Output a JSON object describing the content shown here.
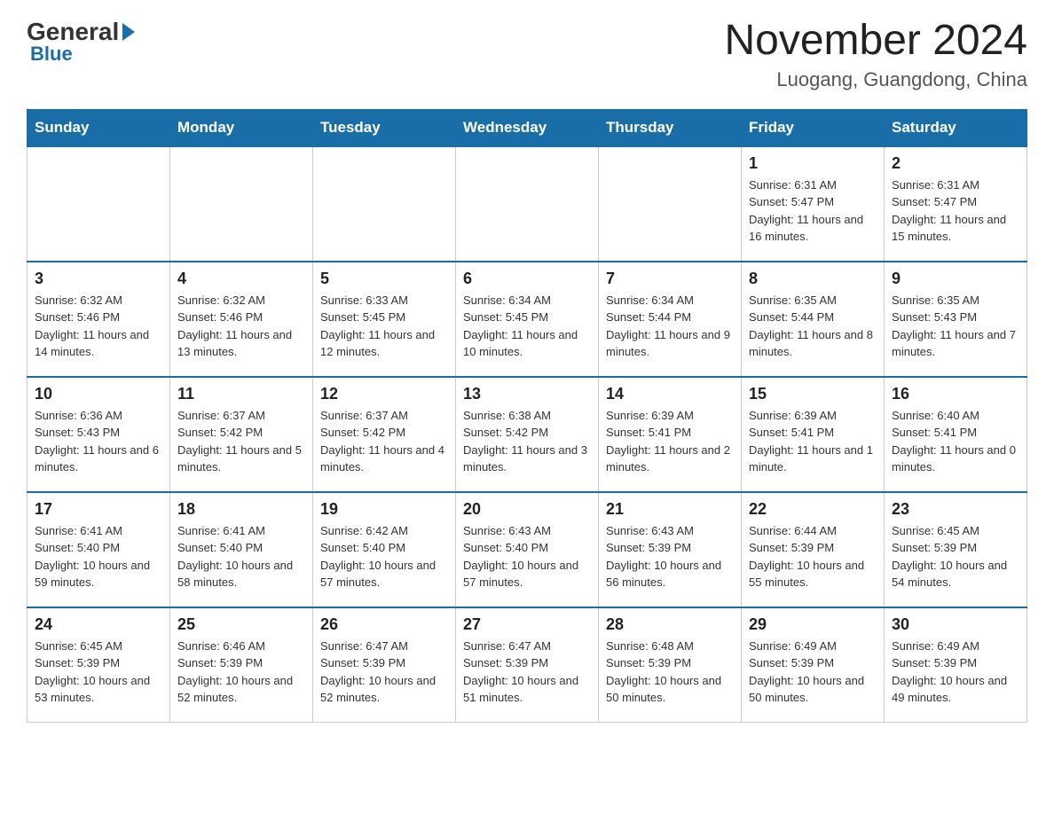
{
  "header": {
    "logo_general": "General",
    "logo_blue": "Blue",
    "month_title": "November 2024",
    "location": "Luogang, Guangdong, China"
  },
  "weekdays": [
    "Sunday",
    "Monday",
    "Tuesday",
    "Wednesday",
    "Thursday",
    "Friday",
    "Saturday"
  ],
  "weeks": [
    [
      {
        "day": "",
        "info": ""
      },
      {
        "day": "",
        "info": ""
      },
      {
        "day": "",
        "info": ""
      },
      {
        "day": "",
        "info": ""
      },
      {
        "day": "",
        "info": ""
      },
      {
        "day": "1",
        "info": "Sunrise: 6:31 AM\nSunset: 5:47 PM\nDaylight: 11 hours and 16 minutes."
      },
      {
        "day": "2",
        "info": "Sunrise: 6:31 AM\nSunset: 5:47 PM\nDaylight: 11 hours and 15 minutes."
      }
    ],
    [
      {
        "day": "3",
        "info": "Sunrise: 6:32 AM\nSunset: 5:46 PM\nDaylight: 11 hours and 14 minutes."
      },
      {
        "day": "4",
        "info": "Sunrise: 6:32 AM\nSunset: 5:46 PM\nDaylight: 11 hours and 13 minutes."
      },
      {
        "day": "5",
        "info": "Sunrise: 6:33 AM\nSunset: 5:45 PM\nDaylight: 11 hours and 12 minutes."
      },
      {
        "day": "6",
        "info": "Sunrise: 6:34 AM\nSunset: 5:45 PM\nDaylight: 11 hours and 10 minutes."
      },
      {
        "day": "7",
        "info": "Sunrise: 6:34 AM\nSunset: 5:44 PM\nDaylight: 11 hours and 9 minutes."
      },
      {
        "day": "8",
        "info": "Sunrise: 6:35 AM\nSunset: 5:44 PM\nDaylight: 11 hours and 8 minutes."
      },
      {
        "day": "9",
        "info": "Sunrise: 6:35 AM\nSunset: 5:43 PM\nDaylight: 11 hours and 7 minutes."
      }
    ],
    [
      {
        "day": "10",
        "info": "Sunrise: 6:36 AM\nSunset: 5:43 PM\nDaylight: 11 hours and 6 minutes."
      },
      {
        "day": "11",
        "info": "Sunrise: 6:37 AM\nSunset: 5:42 PM\nDaylight: 11 hours and 5 minutes."
      },
      {
        "day": "12",
        "info": "Sunrise: 6:37 AM\nSunset: 5:42 PM\nDaylight: 11 hours and 4 minutes."
      },
      {
        "day": "13",
        "info": "Sunrise: 6:38 AM\nSunset: 5:42 PM\nDaylight: 11 hours and 3 minutes."
      },
      {
        "day": "14",
        "info": "Sunrise: 6:39 AM\nSunset: 5:41 PM\nDaylight: 11 hours and 2 minutes."
      },
      {
        "day": "15",
        "info": "Sunrise: 6:39 AM\nSunset: 5:41 PM\nDaylight: 11 hours and 1 minute."
      },
      {
        "day": "16",
        "info": "Sunrise: 6:40 AM\nSunset: 5:41 PM\nDaylight: 11 hours and 0 minutes."
      }
    ],
    [
      {
        "day": "17",
        "info": "Sunrise: 6:41 AM\nSunset: 5:40 PM\nDaylight: 10 hours and 59 minutes."
      },
      {
        "day": "18",
        "info": "Sunrise: 6:41 AM\nSunset: 5:40 PM\nDaylight: 10 hours and 58 minutes."
      },
      {
        "day": "19",
        "info": "Sunrise: 6:42 AM\nSunset: 5:40 PM\nDaylight: 10 hours and 57 minutes."
      },
      {
        "day": "20",
        "info": "Sunrise: 6:43 AM\nSunset: 5:40 PM\nDaylight: 10 hours and 57 minutes."
      },
      {
        "day": "21",
        "info": "Sunrise: 6:43 AM\nSunset: 5:39 PM\nDaylight: 10 hours and 56 minutes."
      },
      {
        "day": "22",
        "info": "Sunrise: 6:44 AM\nSunset: 5:39 PM\nDaylight: 10 hours and 55 minutes."
      },
      {
        "day": "23",
        "info": "Sunrise: 6:45 AM\nSunset: 5:39 PM\nDaylight: 10 hours and 54 minutes."
      }
    ],
    [
      {
        "day": "24",
        "info": "Sunrise: 6:45 AM\nSunset: 5:39 PM\nDaylight: 10 hours and 53 minutes."
      },
      {
        "day": "25",
        "info": "Sunrise: 6:46 AM\nSunset: 5:39 PM\nDaylight: 10 hours and 52 minutes."
      },
      {
        "day": "26",
        "info": "Sunrise: 6:47 AM\nSunset: 5:39 PM\nDaylight: 10 hours and 52 minutes."
      },
      {
        "day": "27",
        "info": "Sunrise: 6:47 AM\nSunset: 5:39 PM\nDaylight: 10 hours and 51 minutes."
      },
      {
        "day": "28",
        "info": "Sunrise: 6:48 AM\nSunset: 5:39 PM\nDaylight: 10 hours and 50 minutes."
      },
      {
        "day": "29",
        "info": "Sunrise: 6:49 AM\nSunset: 5:39 PM\nDaylight: 10 hours and 50 minutes."
      },
      {
        "day": "30",
        "info": "Sunrise: 6:49 AM\nSunset: 5:39 PM\nDaylight: 10 hours and 49 minutes."
      }
    ]
  ]
}
